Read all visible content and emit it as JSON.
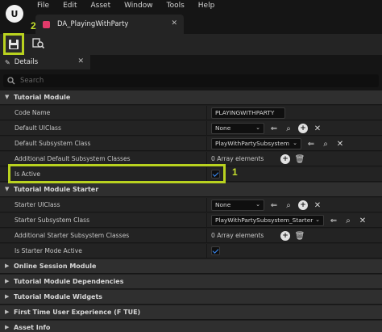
{
  "menubar": {
    "logo": "U",
    "items": [
      "File",
      "Edit",
      "Asset",
      "Window",
      "Tools",
      "Help"
    ]
  },
  "document_tab": {
    "label": "DA_PlayingWithParty",
    "close": "✕"
  },
  "callouts": {
    "save": "2",
    "is_active": "1"
  },
  "details_tab": {
    "label": "Details",
    "close": "✕"
  },
  "search": {
    "placeholder": "Search"
  },
  "sections": {
    "tutorial_module": {
      "label": "Tutorial Module",
      "rows": {
        "code_name": {
          "label": "Code Name",
          "value": "PLAYINGWITHPARTY"
        },
        "default_uiclass": {
          "label": "Default UIClass",
          "value": "None"
        },
        "default_subsystem_class": {
          "label": "Default Subsystem Class",
          "value": "PlayWithPartySubsystem"
        },
        "additional_default_subsystem_classes": {
          "label": "Additional Default Subsystem Classes",
          "value": "0 Array elements"
        },
        "is_active": {
          "label": "Is Active",
          "checked": true
        }
      }
    },
    "tutorial_module_starter": {
      "label": "Tutorial Module Starter",
      "rows": {
        "starter_uiclass": {
          "label": "Starter UIClass",
          "value": "None"
        },
        "starter_subsystem_class": {
          "label": "Starter Subsystem Class",
          "value": "PlayWithPartySubsystem_Starter"
        },
        "additional_starter_subsystem_classes": {
          "label": "Additional Starter Subsystem Classes",
          "value": "0 Array elements"
        },
        "is_starter_mode_active": {
          "label": "Is Starter Mode Active",
          "checked": true
        }
      }
    },
    "collapsed": [
      "Online Session Module",
      "Tutorial Module Dependencies",
      "Tutorial Module Widgets",
      "First Time User Experience (F TUE)",
      "Asset Info"
    ]
  },
  "colors": {
    "callout": "#c5e02d",
    "checkmark": "#3a8fff",
    "tab_icon": "#e23a6a"
  }
}
